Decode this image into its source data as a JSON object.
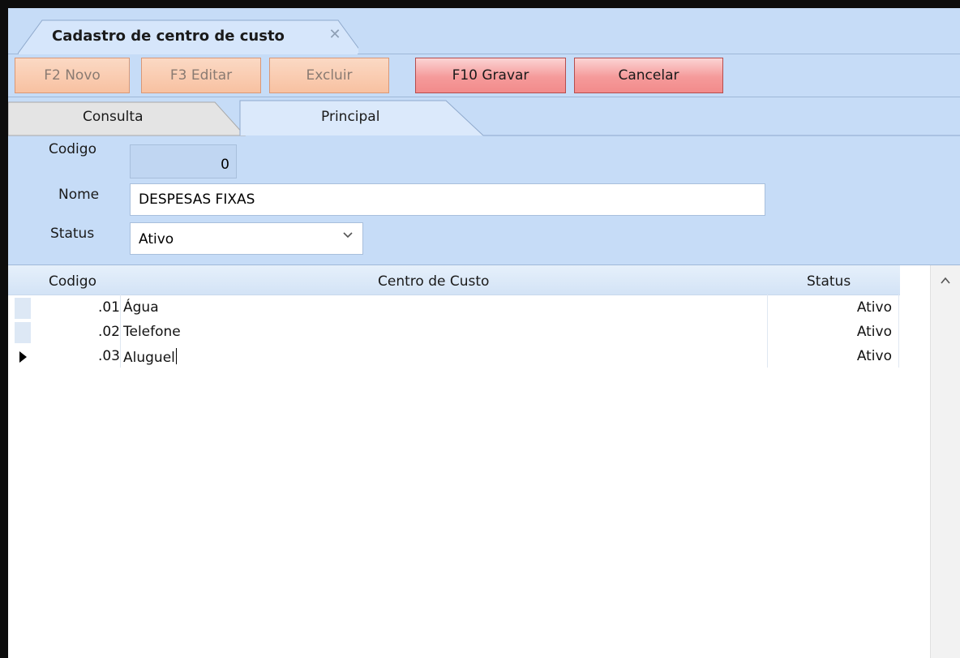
{
  "window": {
    "tab_title": "Cadastro de centro de custo",
    "tab_close": "✕"
  },
  "toolbar": {
    "novo_label": "F2 Novo",
    "editar_label": "F3 Editar",
    "excluir_label": "Excluir",
    "gravar_label": "F10 Gravar",
    "cancelar_label": "Cancelar"
  },
  "tabs": {
    "consulta": "Consulta",
    "principal": "Principal"
  },
  "form": {
    "codigo_label": "Codigo",
    "codigo_value": "0",
    "nome_label": "Nome",
    "nome_value": "DESPESAS FIXAS",
    "status_label": "Status",
    "status_value": "Ativo"
  },
  "grid": {
    "columns": [
      "Codigo",
      "Centro de Custo",
      "Status"
    ],
    "rows": [
      {
        "codigo": ".01",
        "nome": "Água",
        "status": "Ativo"
      },
      {
        "codigo": ".02",
        "nome": "Telefone",
        "status": "Ativo"
      },
      {
        "codigo": ".03",
        "nome": "Aluguel",
        "status": "Ativo"
      }
    ],
    "selected_row": 2
  },
  "icons": {
    "close": "close-icon",
    "dropdown": "chevron-down-icon",
    "row_pointer": "row-pointer-icon",
    "scroll_up": "chevron-up-icon"
  },
  "colors": {
    "panel_bg": "#c6dcf7",
    "active_button": "#f28b8b",
    "disabled_button": "#f8c1a1"
  }
}
